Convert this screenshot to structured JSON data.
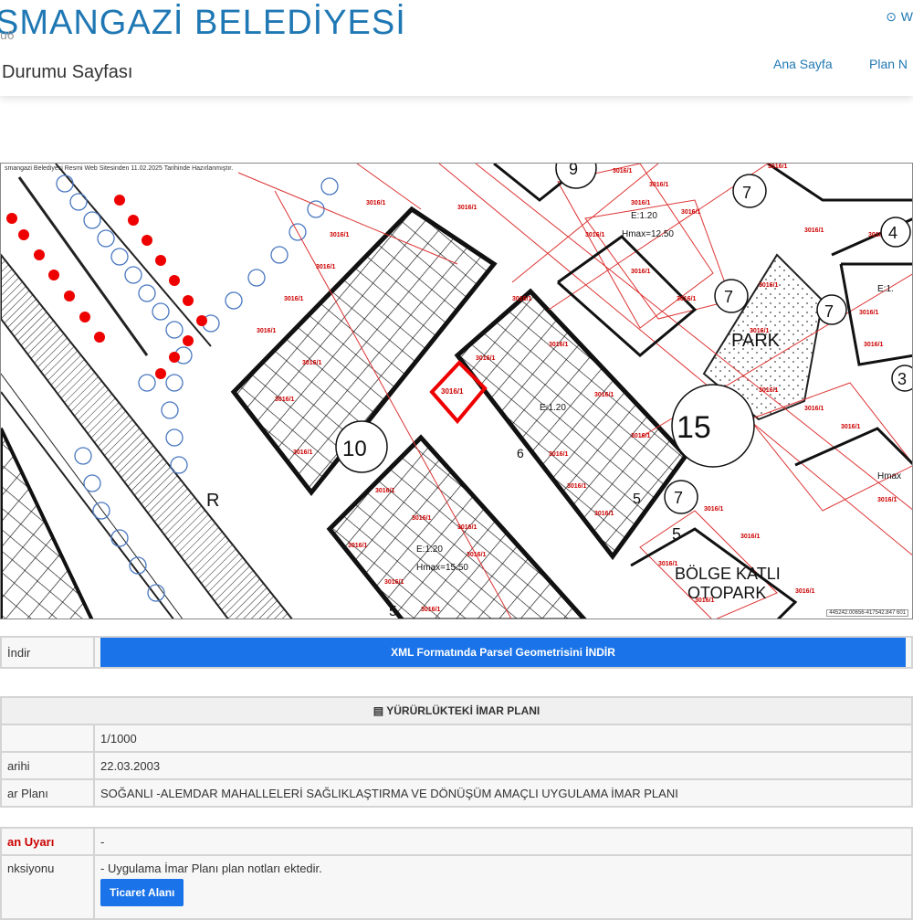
{
  "header": {
    "brand": "SMANGAZİ BELEDİYESİ",
    "brand_ghost": "u6",
    "subtitle": "Durumu Sayfası",
    "nav": [
      "Ana Sayfa",
      "Plan N"
    ],
    "icon_glyph": "⊙",
    "icon_label": "W"
  },
  "map": {
    "caption": "smangazi Belediyesi Resmi Web Sitesinden 11.02.2025 Tarihinde Hazırlanmıştır.",
    "coords": "445242.00656-417542.847 601",
    "labels": {
      "r": "R",
      "park": "PARK",
      "bolge": "BÖLGE KATLI",
      "otopark": "OTOPARK",
      "n15": "15",
      "n10": "10",
      "e1": "E:1.20",
      "hmax": "Hmax=12.50",
      "e2": "E:1.20",
      "hmax2": "Hmax=15.50",
      "e3": "E:1.20",
      "n7a": "7",
      "n7b": "7",
      "n7c": "7",
      "n7d": "7",
      "n5a": "5",
      "n5b": "5",
      "n5c": "5",
      "n9": "9",
      "n4": "4",
      "n3": "3",
      "n6": "6",
      "hmaxr": "Hmax",
      "e4": "E:1.",
      "parcel": "3016/1"
    }
  },
  "download": {
    "label": "İndir",
    "button": "XML Formatında Parsel Geometrisini İNDİR"
  },
  "plan": {
    "section_title": "YÜRÜRLÜKTEKİ İMAR PLANI",
    "section_icon": "▤",
    "rows": [
      {
        "label": "",
        "value": "1/1000"
      },
      {
        "label": "arihi",
        "value": "22.03.2003"
      },
      {
        "label": "ar Planı",
        "value": "SOĞANLI -ALEMDAR MAHALLELERİ SAĞLIKLAŞTIRMA VE DÖNÜŞÜM AMAÇLI UYGULAMA İMAR PLANI"
      }
    ],
    "uyari_label": "an Uyarı",
    "uyari_value": "-",
    "fonksiyon_label": "nksiyonu",
    "fonksiyon_value": "- Uygulama İmar Planı plan notları ektedir.",
    "ticaret": "Ticaret Alanı"
  }
}
